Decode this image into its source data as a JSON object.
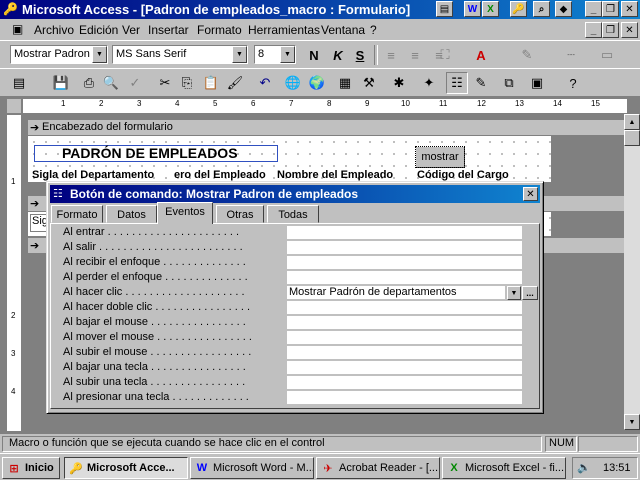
{
  "window": {
    "title": "Microsoft Access - [Padron de empleados_macro : Formulario]"
  },
  "menu": [
    "Archivo",
    "Edición",
    "Ver",
    "Insertar",
    "Formato",
    "Herramientas",
    "Ventana",
    "?"
  ],
  "format_toolbar": {
    "object_select": "Mostrar Padron",
    "font": "MS Sans Serif",
    "size": "8",
    "bold": "N",
    "italic": "K",
    "underline": "S"
  },
  "ruler": [
    "1",
    "2",
    "3",
    "4",
    "5",
    "6",
    "7",
    "8",
    "9",
    "10",
    "11",
    "12",
    "13",
    "14",
    "15"
  ],
  "form": {
    "header_section": "Encabezado del formulario",
    "title_label": "PADRÓN DE EMPLEADOS",
    "button_label": "mostrar",
    "columns": [
      "Sigla del Departamento",
      "ero del Empleado",
      "Nombre del Empleado",
      "Código del Cargo"
    ],
    "detail_field": "Sig"
  },
  "dialog": {
    "title": "Botón de comando: Mostrar Padron de empleados",
    "tabs": [
      "Formato",
      "Datos",
      "Eventos",
      "Otras",
      "Todas"
    ],
    "active_tab": "Eventos",
    "properties": [
      {
        "label": "Al entrar . . . . . . . . . . . . . . . . . . . . . .",
        "value": ""
      },
      {
        "label": "Al salir . . . . . . . . . . . . . . . . . . . . . . . .",
        "value": ""
      },
      {
        "label": "Al recibir el enfoque . . . . . . . . . . . . . .",
        "value": ""
      },
      {
        "label": "Al perder el enfoque . . . . . . . . . . . . . .",
        "value": ""
      },
      {
        "label": "Al hacer clic . . . . . . . . . . . . . . . . . . . .",
        "value": "Mostrar Padrón de departamentos"
      },
      {
        "label": "Al hacer doble clic . . . . . . . . . . . . . . . .",
        "value": ""
      },
      {
        "label": "Al bajar el mouse . . . . . . . . . . . . . . . .",
        "value": ""
      },
      {
        "label": "Al mover el mouse . . . . . . . . . . . . . . . .",
        "value": ""
      },
      {
        "label": "Al subir el mouse . . . . . . . . . . . . . . . . .",
        "value": ""
      },
      {
        "label": "Al bajar una tecla . . . . . . . . . . . . . . . .",
        "value": ""
      },
      {
        "label": "Al subir una tecla . . . . . . . . . . . . . . . .",
        "value": ""
      },
      {
        "label": "Al presionar una tecla . . . . . . . . . . . . .",
        "value": ""
      }
    ]
  },
  "status": {
    "text": "Macro o función que se ejecuta cuando se hace clic en el control",
    "num": "NUM"
  },
  "taskbar": {
    "start": "Inicio",
    "tasks": [
      "Microsoft Acce...",
      "Microsoft Word - M...",
      "Acrobat Reader - [...",
      "Microsoft Excel - fi..."
    ],
    "clock": "13:51"
  },
  "colors": {
    "titlebar": "#000080",
    "face": "#c0c0c0",
    "workspace": "#808080"
  }
}
